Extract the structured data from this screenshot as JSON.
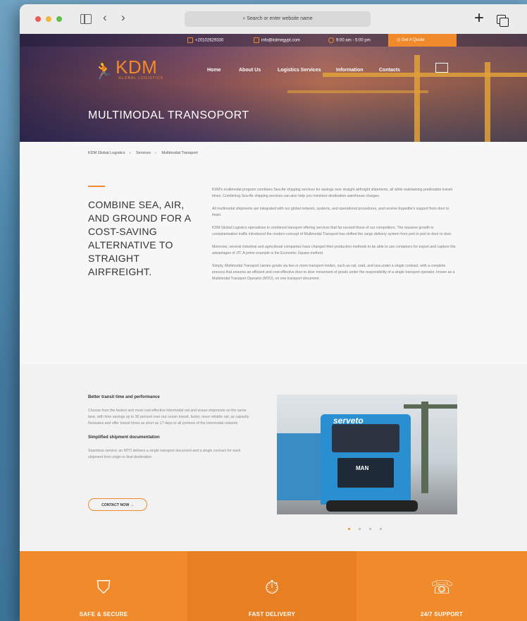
{
  "browser": {
    "url_placeholder": "Search or enter website name"
  },
  "topbar": {
    "phone": "+20102629330",
    "email": "info@kdmegypt.com",
    "hours": "9:00 am - 5:00 pm",
    "quote_label": "Get A Quote"
  },
  "logo": {
    "name": "KDM",
    "sub": "GLOBAL LOGISTICS"
  },
  "nav": {
    "items": [
      "Home",
      "About Us",
      "Logistics Services",
      "Information",
      "Contacts"
    ]
  },
  "hero": {
    "title": "MULTIMODAL TRANSOPORT"
  },
  "breadcrumb": [
    "KDM Global Logistics",
    "Services",
    "Multimodal Transport"
  ],
  "intro": {
    "headline": "COMBINE SEA, AIR, AND GROUND FOR A COST-SAVING ALTERNATIVE TO STRAIGHT AIRFREIGHT.",
    "paragraphs": [
      "KDM's multimodal program combines Sea-Air shipping services for savings over straight airfreight shipments, all while maintaining predictable transit times. Combining Sea-Air shipping services can also help you minimize destination warehouse charges.",
      "All multimodal shipments are integrated with our global network, systems, and operational procedures, and receive Expedite's support from door to finish.",
      "KDM Global Logistics specializes in combined transport offering services that far exceed those of our competitors. The massive growth in containerisation traffic introduced the modern concept of Multimodal Transport has shifted the cargo delivery system from port to port to door to door.",
      "Moreover, several industrial and agricultural companies have changed their production methods to be able to use containers for export and capture the advantages of JIT. A prime example is the Economic Square method.",
      "Simply, Multimodal Transport carries goods via two or more transport modes, such as rail, road, and sea under a single contract, with a complete process that ensures an efficient and cost-effective door to door movement of goods under the responsibility of a single transport operator, known as a Multimodal Transport Operator (MTO), on one transport document."
    ]
  },
  "features": {
    "heading1": "Better transit time and performance",
    "text1": "Choose from the fastest and most cost-effective intermodal rail and ocean shipments on the same lane, with time savings up to 30 percent over our ocean transit, faster, more reliable rail, as capacity fluctuates and offer transit times as short as 17 days to all portions of the Intermodal network.",
    "heading2": "Simplified shipment documentation",
    "text2": "Seamless service: an MTO delivers a single transport document and a single contract for each shipment from origin to final destination.",
    "cta": "CONTACT NOW →",
    "image_brand": "serveto",
    "image_model": "MAN"
  },
  "band": [
    {
      "label": "SAFE & SECURE",
      "icon": "shield-box-icon"
    },
    {
      "label": "FAST DELIVERY",
      "icon": "stopwatch-icon"
    },
    {
      "label": "24/7 SUPPORT",
      "icon": "phone-support-icon"
    }
  ],
  "colors": {
    "accent": "#f08a2a",
    "text": "#333333"
  }
}
